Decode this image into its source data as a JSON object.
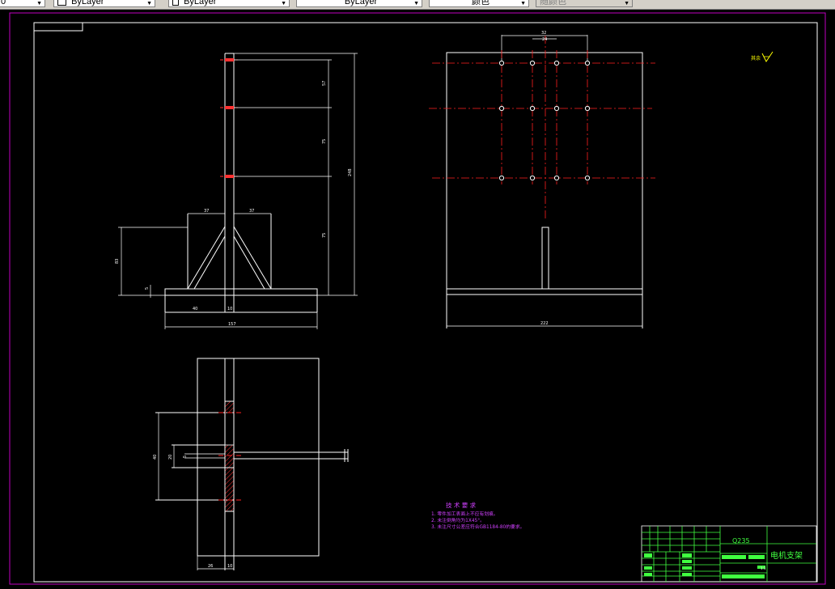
{
  "toolbar": {
    "layer_box": "0",
    "linetype_box": "ByLayer",
    "lineweight_box": "ByLayer",
    "color_box": "ByLayer",
    "plotstyle_box": "颜色",
    "extra_box": "随颜色"
  },
  "dims": {
    "top_view_spacing_a": "57",
    "top_view_spacing_b": "75",
    "top_view_spacing_c": "75",
    "top_view_total": "248",
    "left_bracket": "37",
    "right_bracket": "37",
    "bracket_height": "83",
    "base_thickness": "5",
    "base_offset": "40",
    "post_width": "10",
    "base_width": "157",
    "plate_hole_spacing": "32",
    "plate_hole_inner": "24",
    "plate_width": "222",
    "bottom_hole_span": "40",
    "bottom_hole_inner": "20",
    "bottom_small": "5",
    "bottom_left_w": "26",
    "bottom_post_w": "10"
  },
  "roughness": {
    "label": "其余"
  },
  "tech": {
    "title": "技 术 要 求",
    "lines": [
      "1. 零件加工表面上不应有划痕。",
      "2. 未注倒角均为1X45°。",
      "3. 未注尺寸公差应符合GB1184-80的要求。"
    ]
  },
  "title_block": {
    "material": "Q235",
    "part_name": "电机支架",
    "scale": "1:1"
  },
  "colors": {
    "outline": "#ffffff",
    "centerline": "#ff2020",
    "hatch": "#ff3030",
    "frame": "#c000c0",
    "title_block": "#40ff40",
    "roughness": "#ffff00",
    "tech_text": "#d040ff"
  }
}
